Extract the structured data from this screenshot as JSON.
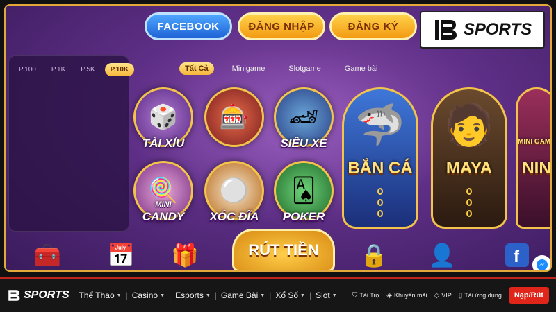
{
  "top_buttons": {
    "facebook": "FACEBOOK",
    "login": "ĐĂNG NHẬP",
    "register": "ĐĂNG KÝ"
  },
  "logo": {
    "text": "SPORTS",
    "letter": "B"
  },
  "jackpot_tabs": [
    "P.100",
    "P.1K",
    "P.5K",
    "P.10K"
  ],
  "filter_tabs": [
    "Tất Cả",
    "Minigame",
    "Slotgame",
    "Game bài"
  ],
  "games": {
    "tai_xiu": "TÀI XỈU",
    "slot777": "",
    "sieu_xe": "SIÊU XE",
    "mini_candy": "CANDY",
    "mini_candy_top": "MINI",
    "xoc_dia": "XÓC ĐĨA",
    "poker": "POKER",
    "ban_ca": "BẮN CÁ",
    "maya": "MAYA",
    "nin": "NIN",
    "mini_game": "MINI GAME"
  },
  "withdraw_button": "RÚT TIỀN",
  "nav": {
    "logo_text": "SPORTS",
    "items": [
      "Thể Thao",
      "Casino",
      "Esports",
      "Game Bài",
      "Xổ Số",
      "Slot"
    ],
    "links": [
      "Tài Trợ",
      "Khuyến mãi",
      "VIP",
      "Tải ứng dụng"
    ],
    "cta": "Nạp/Rút"
  },
  "colors": {
    "gold": "#f3c34a",
    "nav_red": "#e0261b",
    "bg_purple": "#5d2e85"
  }
}
